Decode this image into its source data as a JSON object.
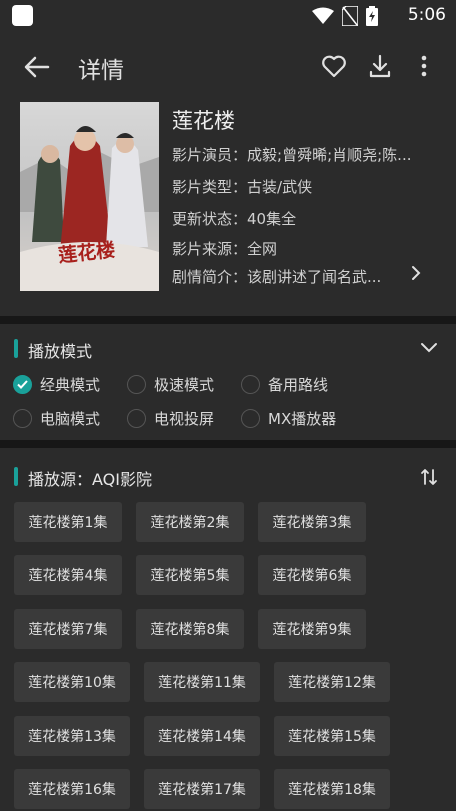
{
  "status": {
    "time": "5:06"
  },
  "header": {
    "title": "详情"
  },
  "movie": {
    "title": "莲花楼",
    "poster_text": "莲花楼",
    "rows": [
      {
        "key": "影片演员：",
        "value": "成毅;曾舜晞;肖顺尧;陈..."
      },
      {
        "key": "影片类型：",
        "value": "古装/武侠"
      },
      {
        "key": "更新状态：",
        "value": "40集全"
      },
      {
        "key": "影片来源：",
        "value": "全网"
      },
      {
        "key": "剧情简介：",
        "value": "该剧讲述了闻名武..."
      }
    ]
  },
  "play_mode": {
    "title": "播放模式",
    "options": [
      "经典模式",
      "极速模式",
      "备用路线",
      "电脑模式",
      "电视投屏",
      "MX播放器"
    ],
    "selected_index": 0
  },
  "source": {
    "title": "播放源：AQI影院",
    "episodes": [
      "莲花楼第1集",
      "莲花楼第2集",
      "莲花楼第3集",
      "莲花楼第4集",
      "莲花楼第5集",
      "莲花楼第6集",
      "莲花楼第7集",
      "莲花楼第8集",
      "莲花楼第9集",
      "莲花楼第10集",
      "莲花楼第11集",
      "莲花楼第12集",
      "莲花楼第13集",
      "莲花楼第14集",
      "莲花楼第15集",
      "莲花楼第16集",
      "莲花楼第17集",
      "莲花楼第18集"
    ]
  },
  "colors": {
    "accent": "#1aa19a",
    "background": "#2b2b2b",
    "chip": "#3a3a3a"
  },
  "icons": [
    "back-arrow-icon",
    "heart-icon",
    "download-icon",
    "more-vert-icon",
    "chevron-right-icon",
    "chevron-down-icon",
    "sort-icon",
    "wifi-icon",
    "no-sim-icon",
    "battery-icon"
  ]
}
